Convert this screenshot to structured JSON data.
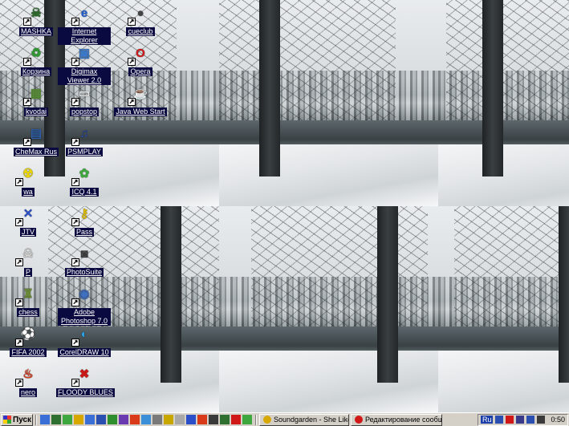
{
  "desktop": {
    "icons": [
      {
        "label": "MASHKA",
        "icon": "skull-icon",
        "color": "#2d6b2d"
      },
      {
        "label": "Internet Explorer",
        "icon": "internet-explorer-icon",
        "color": "#1f5fd6"
      },
      {
        "label": "cueclub",
        "icon": "cueclub-icon",
        "color": "#444444"
      },
      {
        "label": "Корзина",
        "icon": "recycle-bin-icon",
        "color": "#2f9b2f"
      },
      {
        "label": "Digimax Viewer 2.0",
        "icon": "digimax-viewer-icon",
        "color": "#3b78c8"
      },
      {
        "label": "Opera",
        "icon": "opera-icon",
        "color": "#d01818"
      },
      {
        "label": "kvodai",
        "icon": "kvodai-icon",
        "color": "#5a8f3a"
      },
      {
        "label": "popstop",
        "icon": "popstop-icon",
        "color": "#e8e8e8"
      },
      {
        "label": "Java Web Start",
        "icon": "java-icon",
        "color": "#c63b1f"
      },
      {
        "label": "CheMax Rus",
        "icon": "chemax-icon",
        "color": "#2f5fa8"
      },
      {
        "label": "PSMPLAY",
        "icon": "psmplay-icon",
        "color": "#2a4fb0"
      },
      {
        "label": "wa",
        "icon": "radiation-icon",
        "color": "#e8d400"
      },
      {
        "label": "ICQ 4.1",
        "icon": "icq-flower-icon",
        "color": "#3ea83e"
      },
      {
        "label": "JTV",
        "icon": "jtv-icon",
        "color": "#2a4fc8"
      },
      {
        "label": "Pass",
        "icon": "key-icon",
        "color": "#d8b800"
      },
      {
        "label": "P",
        "icon": "skull-icon",
        "color": "#cfcfcf"
      },
      {
        "label": "PhotoSuite",
        "icon": "camera-icon",
        "color": "#3a3a3a"
      },
      {
        "label": "chess",
        "icon": "chess-icon",
        "color": "#6a8a3a"
      },
      {
        "label": "Adobe Photoshop 7.0",
        "icon": "photoshop-eye-icon",
        "color": "#3f6fc0"
      },
      {
        "label": "FIFA 2002",
        "icon": "fifa-icon",
        "color": "#555555"
      },
      {
        "label": "CorelDRAW 10",
        "icon": "coreldraw-icon",
        "color": "#2aa0e0"
      },
      {
        "label": "nero",
        "icon": "nero-flame-icon",
        "color": "#d83a1a"
      },
      {
        "label": "FLOODY BLUES",
        "icon": "floody-blues-icon",
        "color": "#c81818"
      }
    ]
  },
  "taskbar": {
    "start_label": "Пуск",
    "quick_launch": [
      {
        "icon": "show-desktop-icon",
        "color": "#3a6fd8"
      },
      {
        "icon": "media-player-icon",
        "color": "#2f6f2f"
      },
      {
        "icon": "icq-icon",
        "color": "#3ea83e"
      },
      {
        "icon": "explorer-icon",
        "color": "#d8a800"
      },
      {
        "icon": "outlook-icon",
        "color": "#3a6fd8"
      },
      {
        "icon": "word-icon",
        "color": "#2a4fb0"
      },
      {
        "icon": "excel-icon",
        "color": "#2f8f2f"
      },
      {
        "icon": "app-icon",
        "color": "#6a3ab0"
      },
      {
        "icon": "app-icon",
        "color": "#d83a1a"
      },
      {
        "icon": "app-icon",
        "color": "#3a8fd8"
      },
      {
        "icon": "notepad-icon",
        "color": "#7a7a7a"
      },
      {
        "icon": "app-icon",
        "color": "#c8a800"
      },
      {
        "icon": "cd-icon",
        "color": "#a8a8a8"
      },
      {
        "icon": "app-icon",
        "color": "#2a4fc8"
      },
      {
        "icon": "app-icon",
        "color": "#d83a1a"
      },
      {
        "icon": "app-icon",
        "color": "#3a3a3a"
      },
      {
        "icon": "app-icon",
        "color": "#2f6f2f"
      },
      {
        "icon": "opera-icon",
        "color": "#d01818"
      },
      {
        "icon": "app-icon",
        "color": "#3ea83e"
      }
    ],
    "buttons": [
      {
        "label": "Soundgarden - She Likes...",
        "icon": "winamp-icon",
        "color": "#d8a800"
      },
      {
        "label": "Редактирование сообще...",
        "icon": "opera-icon",
        "color": "#d01818"
      }
    ],
    "tray": {
      "lang": "Ru",
      "icons": [
        {
          "icon": "network-icon",
          "color": "#2a4fb0"
        },
        {
          "icon": "antivirus-icon",
          "color": "#d01818"
        },
        {
          "icon": "grid-icon",
          "color": "#3a3a8a"
        },
        {
          "icon": "monitor-icon",
          "color": "#2a4fb0"
        },
        {
          "icon": "volume-icon",
          "color": "#3a3a3a"
        }
      ],
      "clock": "0:50"
    }
  }
}
